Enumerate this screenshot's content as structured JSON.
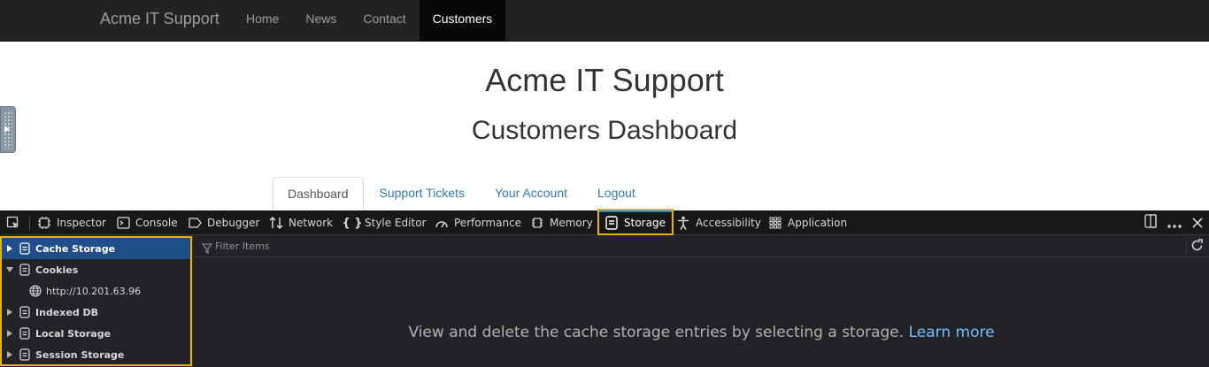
{
  "navbar": {
    "brand": "Acme IT Support",
    "links": [
      "Home",
      "News",
      "Contact",
      "Customers"
    ],
    "active": "Customers"
  },
  "page": {
    "title": "Acme IT Support",
    "subtitle": "Customers Dashboard",
    "tabs": [
      "Dashboard",
      "Support Tickets",
      "Your Account",
      "Logout"
    ],
    "active_tab": "Dashboard"
  },
  "devtools": {
    "tabs": [
      {
        "label": "Inspector",
        "icon": "inspector-icon"
      },
      {
        "label": "Console",
        "icon": "console-icon"
      },
      {
        "label": "Debugger",
        "icon": "debugger-icon"
      },
      {
        "label": "Network",
        "icon": "network-icon"
      },
      {
        "label": "Style Editor",
        "icon": "style-editor-icon"
      },
      {
        "label": "Performance",
        "icon": "performance-icon"
      },
      {
        "label": "Memory",
        "icon": "memory-icon"
      },
      {
        "label": "Storage",
        "icon": "storage-icon"
      },
      {
        "label": "Accessibility",
        "icon": "accessibility-icon"
      },
      {
        "label": "Application",
        "icon": "application-icon"
      }
    ],
    "selected_tab": "Storage",
    "tree": [
      {
        "label": "Cache Storage",
        "expanded": false,
        "selected": true
      },
      {
        "label": "Cookies",
        "expanded": true,
        "selected": false
      },
      {
        "label": "http://10.201.63.96",
        "child": true
      },
      {
        "label": "Indexed DB",
        "expanded": false,
        "selected": false
      },
      {
        "label": "Local Storage",
        "expanded": false,
        "selected": false
      },
      {
        "label": "Session Storage",
        "expanded": false,
        "selected": false
      }
    ],
    "filter_placeholder": "Filter Items",
    "empty_message": "View and delete the cache storage entries by selecting a storage.",
    "learn_more": "Learn more",
    "colors": {
      "highlight": "#e8b500",
      "selected_row": "#204e8a",
      "link": "#75bfff",
      "accent": "#0a84ff"
    }
  }
}
